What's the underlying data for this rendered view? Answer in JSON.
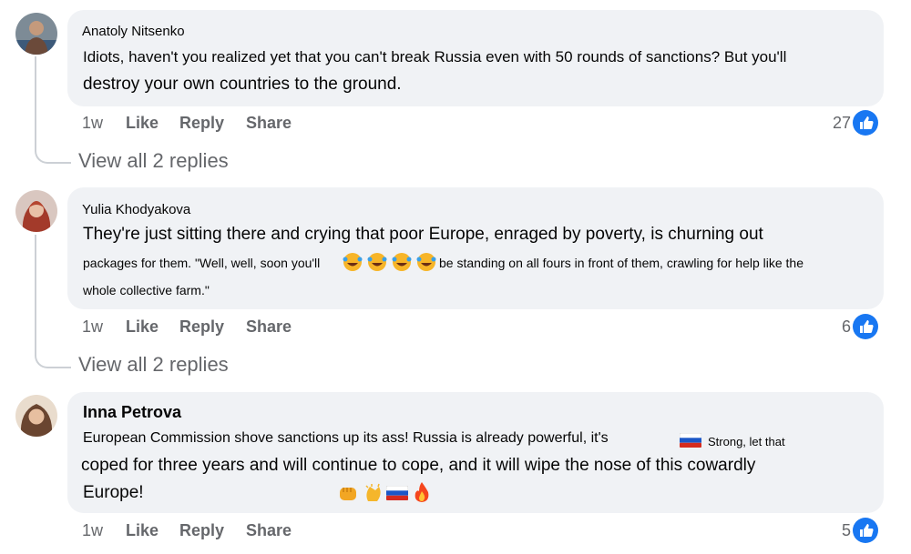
{
  "comments": [
    {
      "author": "Anatoly Nitsenko",
      "lines": [
        "Idiots, haven't you realized yet that you can't break Russia even with 50 rounds of sanctions? But you'll",
        "destroy your own countries to the ground."
      ],
      "age": "1w",
      "like_label": "Like",
      "reply_label": "Reply",
      "share_label": "Share",
      "like_count": "27",
      "view_replies": "View all 2 replies"
    },
    {
      "author": "Yulia Khodyakova",
      "lines": [
        "They're just sitting there and crying that poor Europe, enraged by poverty, is churning out",
        "packages for them. \"Well, well, soon you'll",
        "be standing on all fours in front of them, crawling for help like the",
        "whole collective farm.\""
      ],
      "age": "1w",
      "like_label": "Like",
      "reply_label": "Reply",
      "share_label": "Share",
      "like_count": "6",
      "view_replies": "View all 2 replies"
    },
    {
      "author": "Inna Petrova",
      "lines": [
        "European Commission shove sanctions up its ass! Russia is already powerful, it's",
        "Strong, let that",
        "coped for three years and will continue to cope, and it will wipe the nose of this cowardly",
        "Europe!"
      ],
      "age": "1w",
      "like_label": "Like",
      "reply_label": "Reply",
      "share_label": "Share",
      "like_count": "5"
    }
  ],
  "icons": [
    "avatar",
    "like-thumb-icon",
    "laughing-emoji",
    "fist-emoji",
    "clapping-emoji",
    "russia-flag-emoji",
    "fire-emoji"
  ],
  "colors": {
    "bubble": "#f0f2f5",
    "muted": "#65676b",
    "like_blue": "#1877f2"
  }
}
